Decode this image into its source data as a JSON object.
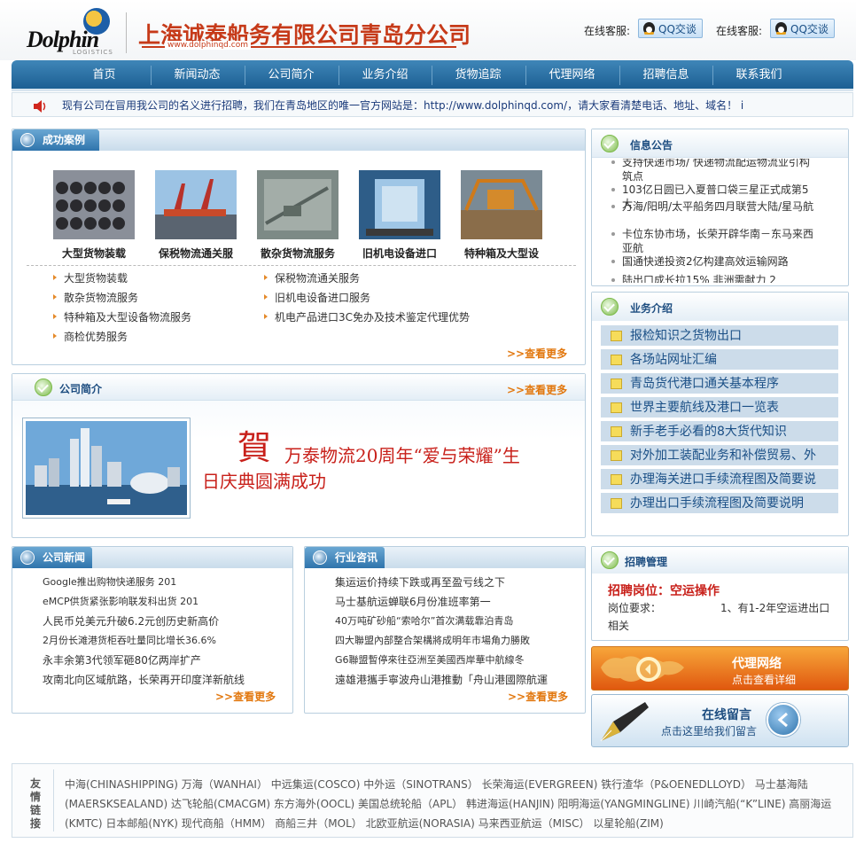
{
  "header": {
    "logo_text": "Dolphin",
    "logo_sub": "LOGISTICS",
    "company_name": "上海诚泰船务有限公司青岛分公司",
    "company_url": "www.dolphinqd.com",
    "qq": [
      {
        "label": "在线客服:",
        "button": "QQ交谈"
      },
      {
        "label": "在线客服:",
        "button": "QQ交谈"
      }
    ]
  },
  "nav": [
    "首页",
    "新闻动态",
    "公司简介",
    "业务介绍",
    "货物追踪",
    "代理网络",
    "招聘信息",
    "联系我们"
  ],
  "marquee": "现有公司在冒用我公司的名义进行招聘，我们在青岛地区的唯一官方网站是：http://www.dolphinqd.com/，请大家看清楚电话、地址、域名！ i",
  "success": {
    "title": "成功案例",
    "thumbs": [
      "大型货物装载",
      "保税物流通关服",
      "散杂货物流服务",
      "旧机电设备进口",
      "特种箱及大型设"
    ],
    "list_left": [
      "大型货物装载",
      "散杂货物流服务",
      "特种箱及大型设备物流服务",
      "商检优势服务"
    ],
    "list_right": [
      "保税物流通关服务",
      "旧机电设备进口服务",
      "机电产品进口3C免办及技术鉴定代理优势"
    ],
    "more": ">>查看更多"
  },
  "intro": {
    "title": "公司简介",
    "more": ">>查看更多",
    "he": "賀",
    "line1": "万泰物流20周年“爱与荣耀”生",
    "line2": "日庆典圆满成功"
  },
  "notice": {
    "title": "信息公告",
    "items": [
      "支持快递市场/ 快递物流配运物流业引构筑点",
      "103亿日圆已入夏普口袋三星正式成第5大",
      "万海/阳明/太平船务四月联营大陆/星马航",
      "卡位东协市场，长荣开辟华南－东马来西亚航",
      "国通快递投资2亿构建高效运输网路",
      "陆出口成长拉15% 非洲需献力 2"
    ]
  },
  "business": {
    "title": "业务介绍",
    "items": [
      "报检知识之货物出口",
      "各场站网址汇编",
      "青岛货代港口通关基本程序",
      "世界主要航线及港口一览表",
      "新手老手必看的8大货代知识",
      "对外加工装配业务和补偿贸易、外",
      "办理海关进口手续流程图及简要说",
      "办理出口手续流程图及简要说明"
    ]
  },
  "company_news": {
    "title": "公司新闻",
    "items": [
      "Google推出购物快递服务 201",
      "eMCP供货紧张影响联发科出货 201",
      "人民币兑美元升破6.2元创历史新高价",
      "2月份长滩港货柜吞吐量同比增长36.6%",
      "永丰余第3代领军砸80亿两岸扩产",
      "攻南北向区域航路，长荣再开印度洋新航线"
    ],
    "more": ">>查看更多"
  },
  "industry_news": {
    "title": "行业咨讯",
    "items": [
      "集运运价持续下跌或再至盈亏线之下",
      "马士基航运蝉联6月份准班率第一",
      "40万吨矿砂船“索哈尔”首次满载靠泊青岛",
      "四大聯盟內部整合架構將成明年市場角力勝敗",
      "G6聯盟暫停來往亞洲至美國西岸華中航線冬",
      "遠雄港攜手寧波舟山港推動「舟山港國際航運"
    ],
    "more": ">>查看更多"
  },
  "recruit": {
    "title": "招聘管理",
    "position": "招聘岗位：空运操作",
    "req_label": "岗位要求：",
    "req_text": "1、有1-2年空运进出口",
    "req_more": "相关"
  },
  "agent_banner": {
    "title": "代理网络",
    "sub": "点击查看详细"
  },
  "message_banner": {
    "title": "在线留言",
    "sub": "点击这里给我们留言"
  },
  "links": {
    "label": "友情链接",
    "text": "中海(CHINASHIPPING) 万海（WANHAI） 中远集运(COSCO) 中外运（SINOTRANS） 长荣海运(EVERGREEN) 铁行渣华（P&OENEDLLOYD） 马士基海陆(MAERSKSEALAND) 达飞轮船(CMACGM) 东方海外(OOCL) 美国总统轮船（APL） 韩进海运(HANJIN) 阳明海运(YANGMINGLINE) 川崎汽船(“K”LINE) 高丽海运(KMTC) 日本邮船(NYK) 现代商船（HMM） 商船三井（MOL） 北欧亚航运(NORASIA) 马来西亚航运（MISC） 以星轮船(ZIM)"
  }
}
